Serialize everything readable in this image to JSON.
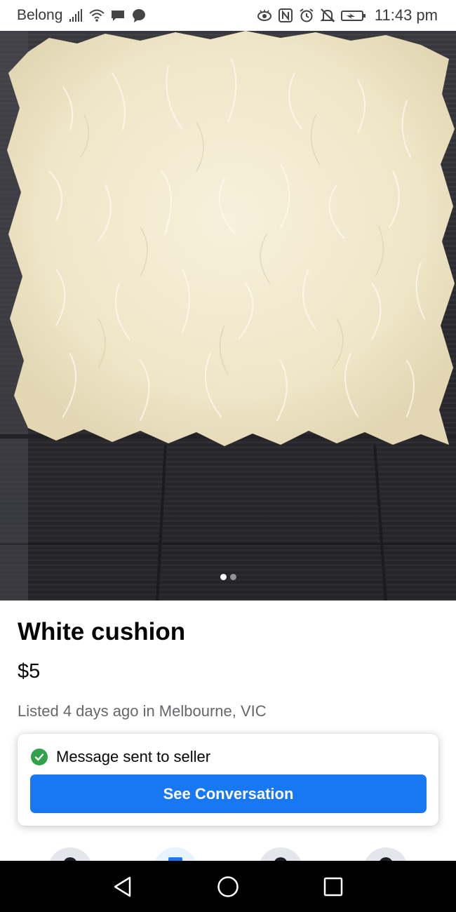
{
  "status_bar": {
    "carrier": "Belong",
    "time": "11:43 pm",
    "icons": [
      "signal-icon",
      "wifi-icon",
      "chat-icon",
      "messenger-icon",
      "eye-icon",
      "nfc-icon",
      "alarm-icon",
      "mute-icon",
      "battery-icon"
    ]
  },
  "photo": {
    "description_icon": "listing-photo",
    "page_index": 1,
    "page_count": 2
  },
  "listing": {
    "title": "White cushion",
    "price": "$5",
    "listed": "Listed 4 days ago in Melbourne, VIC"
  },
  "message_card": {
    "status_text": "Message sent to seller",
    "button_label": "See Conversation"
  },
  "colors": {
    "accent": "#1877f2",
    "success": "#31a24c",
    "muted_text": "#65676b"
  },
  "nav": {
    "items": [
      "back-icon",
      "home-icon",
      "recents-icon"
    ]
  }
}
